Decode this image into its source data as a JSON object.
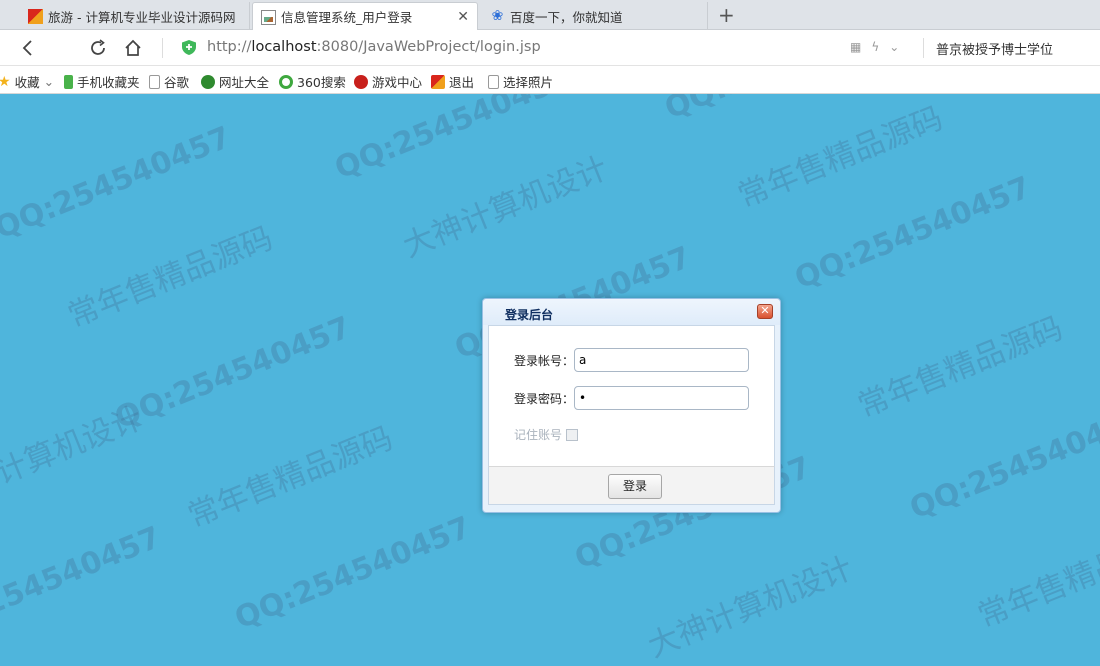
{
  "tabs": [
    {
      "label": "旅游 - 计算机专业毕业设计源码网",
      "active": false
    },
    {
      "label": "信息管理系统_用户登录",
      "active": true
    },
    {
      "label": "百度一下，你就知道",
      "active": false
    }
  ],
  "address": {
    "url_prefix": "http://",
    "url_host": "localhost",
    "url_rest": ":8080/JavaWebProject/login.jsp",
    "search_hint": "普京被授予博士学位"
  },
  "bookmarks": [
    {
      "label": "收藏",
      "icon": "star-icon"
    },
    {
      "label": "手机收藏夹",
      "icon": "phone-icon"
    },
    {
      "label": "谷歌",
      "icon": "page-icon"
    },
    {
      "label": "网址大全",
      "icon": "nav-icon"
    },
    {
      "label": "360搜索",
      "icon": "360-icon"
    },
    {
      "label": "游戏中心",
      "icon": "game-icon"
    },
    {
      "label": "退出",
      "icon": "exit-icon"
    },
    {
      "label": "选择照片",
      "icon": "page-icon"
    }
  ],
  "dialog": {
    "title": "登录后台",
    "close_glyph": "✕",
    "account_label": "登录帐号：",
    "account_value": "a",
    "password_label": "登录密码：",
    "password_value": "•",
    "remember_label": "记住账号",
    "login_button": "登录"
  },
  "watermarks": {
    "qq": "QQ:254540457",
    "slogan1": "常年售精品源码",
    "slogan2": "大神计算机设计"
  }
}
